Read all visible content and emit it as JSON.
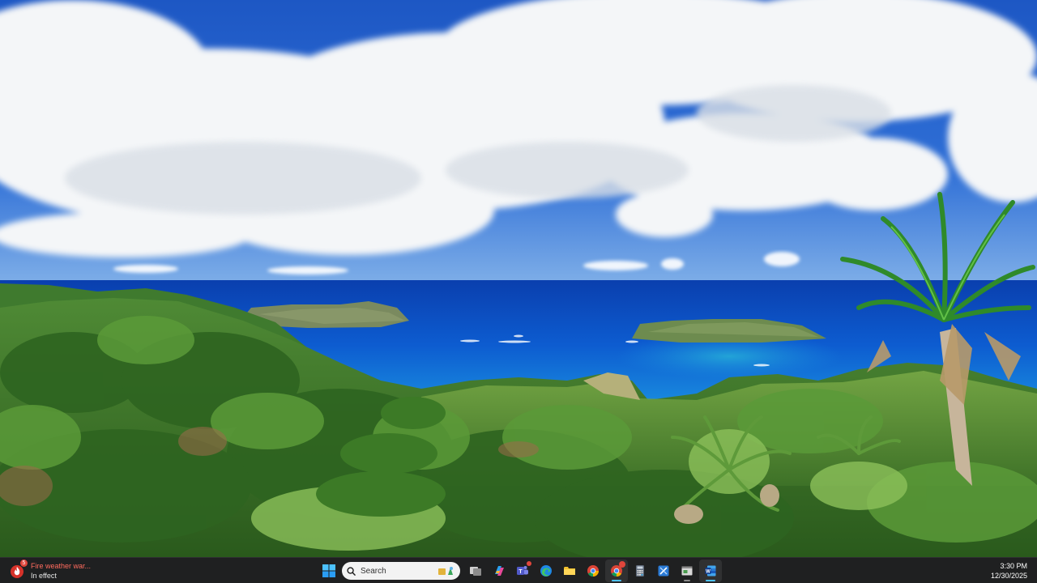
{
  "taskbar": {
    "weather": {
      "title": "Fire weather war...",
      "subtitle": "In effect",
      "badge": "5",
      "icon": "fire-warning-icon"
    },
    "search": {
      "placeholder": "Search"
    },
    "apps": [
      {
        "name": "start-button",
        "icon": "windows-logo-icon"
      },
      {
        "name": "search-box",
        "icon": "search-icon"
      },
      {
        "name": "task-view-button",
        "icon": "task-view-icon"
      },
      {
        "name": "copilot-button",
        "icon": "copilot-icon"
      },
      {
        "name": "teams-button",
        "icon": "teams-icon"
      },
      {
        "name": "edge-button",
        "icon": "edge-icon"
      },
      {
        "name": "file-explorer-button",
        "icon": "folder-icon"
      },
      {
        "name": "chrome-button",
        "icon": "chrome-icon"
      },
      {
        "name": "chrome-profile-button",
        "icon": "chrome-icon"
      },
      {
        "name": "calculator-button",
        "icon": "calculator-icon"
      },
      {
        "name": "snipping-tool-button",
        "icon": "snip-icon"
      },
      {
        "name": "app-window-button",
        "icon": "window-icon"
      },
      {
        "name": "word-button",
        "icon": "word-icon"
      }
    ],
    "clock": {
      "time": "3:30 PM",
      "date": "12/30/2025"
    }
  },
  "colors": {
    "taskbar_bg": "#1f2021",
    "accent": "#4cc2ff",
    "alert": "#e0463c"
  }
}
